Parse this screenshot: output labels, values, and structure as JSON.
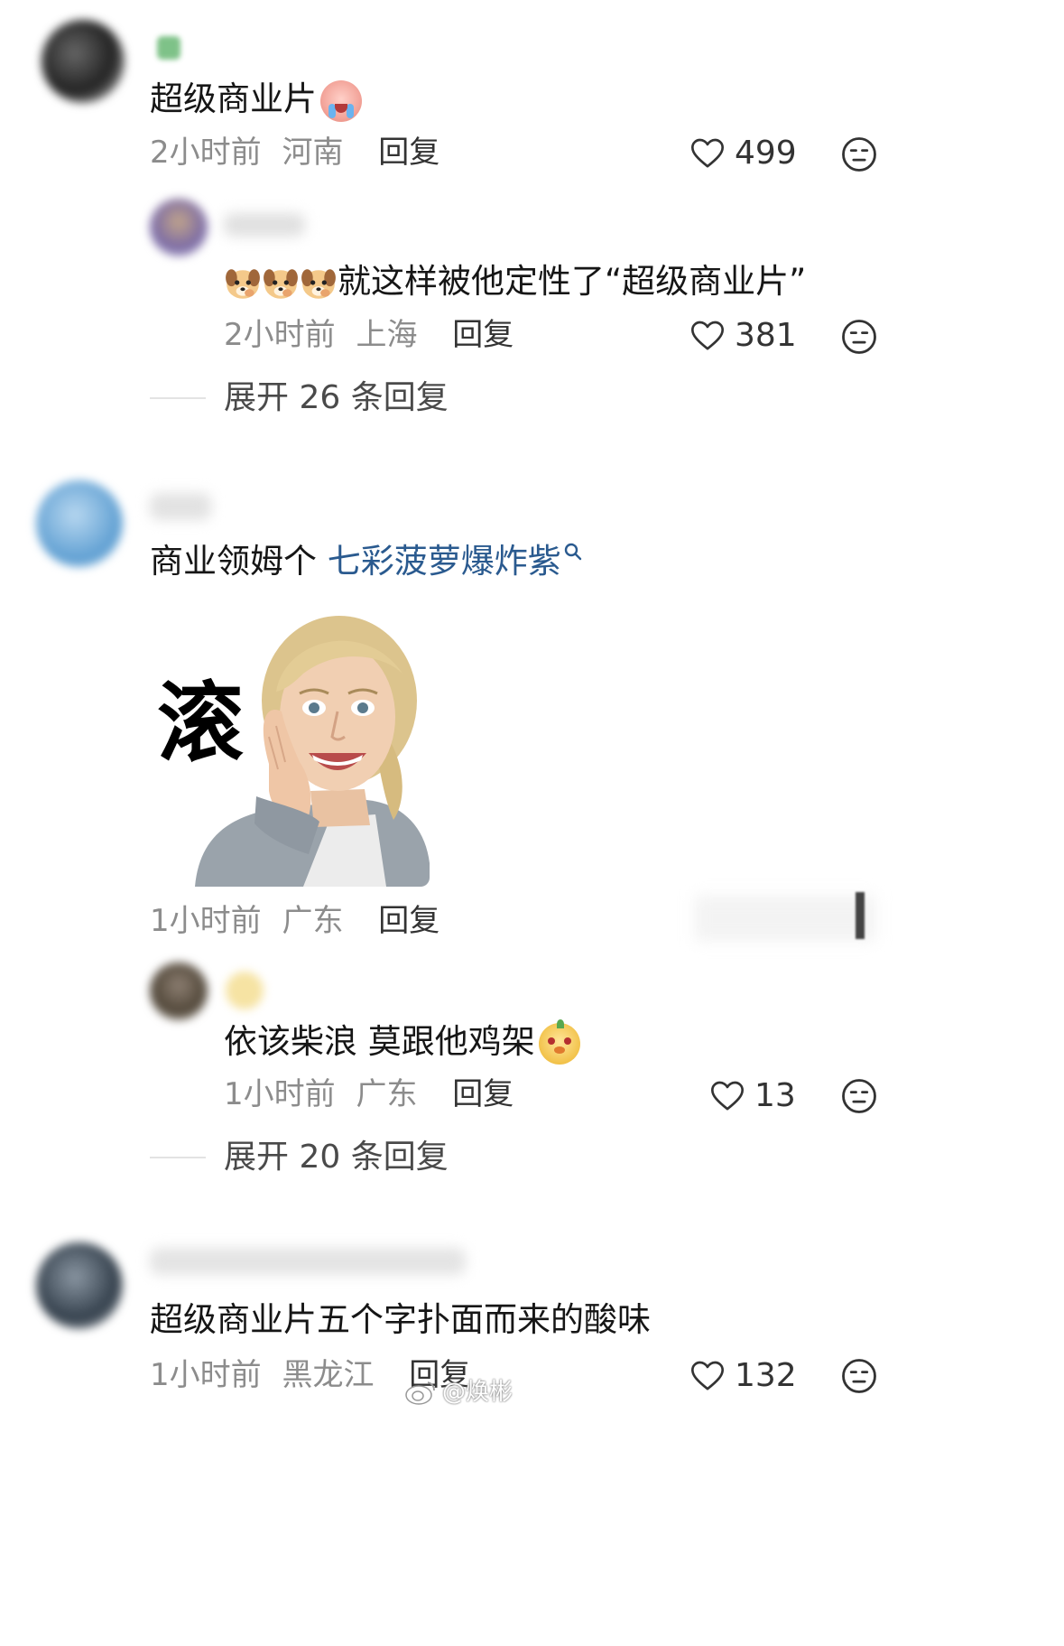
{
  "comments": [
    {
      "text": "超级商业片",
      "time": "2小时前",
      "location": "河南",
      "reply_label": "回复",
      "likes": "499",
      "replies": [
        {
          "text": "就这样被他定性了“超级商业片”",
          "time": "2小时前",
          "location": "上海",
          "reply_label": "回复",
          "likes": "381"
        }
      ],
      "expand_label": "展开 26 条回复"
    },
    {
      "text_prefix": "商业领姆个",
      "link_text": "七彩菠萝爆炸紫",
      "image_caption": "滚",
      "time": "1小时前",
      "location": "广东",
      "reply_label": "回复",
      "replies": [
        {
          "text": "依该柴浪 莫跟他鸡架",
          "time": "1小时前",
          "location": "广东",
          "reply_label": "回复",
          "likes": "13"
        }
      ],
      "expand_label": "展开 20 条回复"
    },
    {
      "text": "超级商业片五个字扑面而来的酸味",
      "time": "1小时前",
      "location": "黑龙江",
      "reply_label": "回复",
      "likes": "132"
    }
  ],
  "watermark": "@焕彬",
  "colors": {
    "link": "#2a5a8f",
    "meta": "#8c8c8c",
    "text": "#161616"
  }
}
